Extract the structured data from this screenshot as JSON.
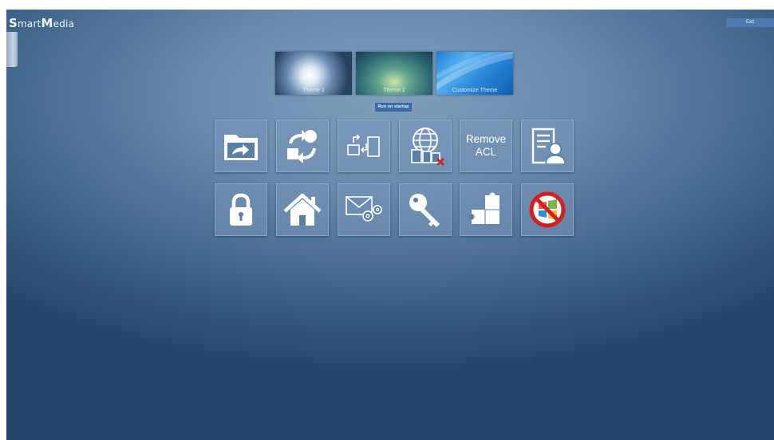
{
  "app": {
    "logo_text": "SmartMedia",
    "logo_part1_cap": "S",
    "logo_part1_rest": "mart",
    "logo_part2_cap": "M",
    "logo_part2_rest": "edia"
  },
  "header": {
    "exit_label": "Exit"
  },
  "themes": [
    {
      "label": "Theme 1"
    },
    {
      "label": "Theme 2"
    },
    {
      "label": "Customize Theme"
    }
  ],
  "startup": {
    "label": "Run on startup"
  },
  "tiles": {
    "row1": [
      {
        "icon": "folder-arrow-icon"
      },
      {
        "icon": "sync-user-icon"
      },
      {
        "icon": "transfer-devices-icon"
      },
      {
        "icon": "globe-devices-blocked-icon"
      },
      {
        "text_line1": "Remove",
        "text_line2": "ACL"
      },
      {
        "icon": "user-document-icon"
      }
    ],
    "row2": [
      {
        "icon": "padlock-icon"
      },
      {
        "icon": "home-icon"
      },
      {
        "icon": "mail-settings-icon"
      },
      {
        "icon": "key-icon"
      },
      {
        "icon": "puzzle-icon"
      },
      {
        "icon": "no-windows-icon"
      }
    ]
  },
  "colors": {
    "accent": "#3a6aa8",
    "exit_button": "#4f79b1",
    "tile_overlay": "#7896b9",
    "prohibit_red": "#d32020"
  }
}
